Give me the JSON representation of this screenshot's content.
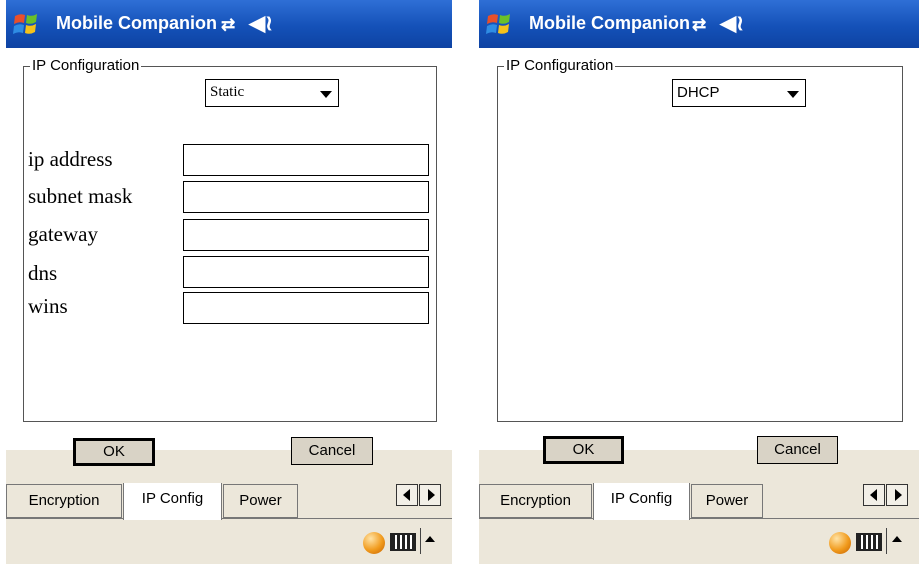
{
  "screens": [
    {
      "title": "Mobile Companion",
      "group_label": "IP Configuration",
      "mode": "Static",
      "fields": [
        {
          "label": "ip address",
          "value": ""
        },
        {
          "label": "subnet mask",
          "value": ""
        },
        {
          "label": "gateway",
          "value": ""
        },
        {
          "label": "dns",
          "value": ""
        },
        {
          "label": "wins",
          "value": ""
        }
      ],
      "ok_label": "OK",
      "cancel_label": "Cancel",
      "tabs": [
        "Encryption",
        "IP Config",
        "Power"
      ],
      "active_tab": "IP Config"
    },
    {
      "title": "Mobile Companion",
      "group_label": "IP Configuration",
      "mode": "DHCP",
      "ok_label": "OK",
      "cancel_label": "Cancel",
      "tabs": [
        "Encryption",
        "IP Config",
        "Power"
      ],
      "active_tab": "IP Config"
    }
  ],
  "icons": {
    "start": "windows-logo-icon",
    "connectivity": "connectivity-icon",
    "volume": "speaker-icon",
    "input_panel": "keyboard-icon"
  },
  "colors": {
    "titlebar": "#1451b8",
    "chrome": "#ece7da",
    "content": "#ffffff"
  }
}
